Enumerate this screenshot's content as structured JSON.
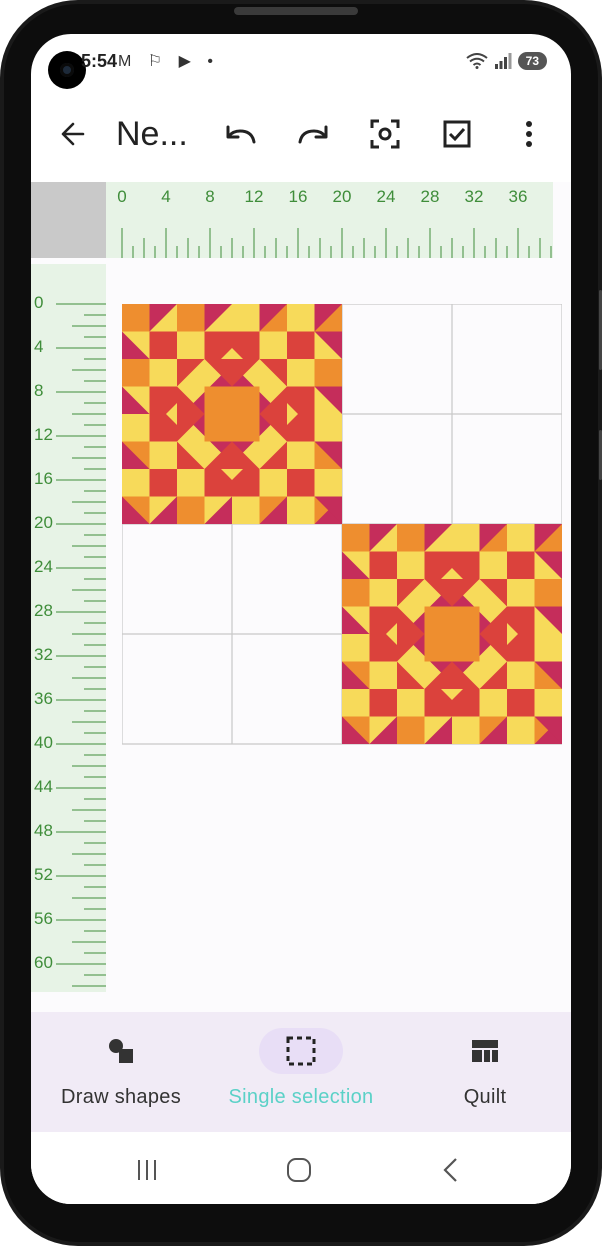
{
  "status_bar": {
    "time": "5:54",
    "notification_icons": [
      "gmail-icon",
      "notification-icon",
      "app-icon",
      "dot-icon"
    ],
    "battery": "73"
  },
  "toolbar": {
    "title": "Ne...",
    "actions": [
      "back-arrow-icon",
      "undo-icon",
      "redo-icon",
      "focus-icon",
      "check-box-icon",
      "more-vert-icon"
    ]
  },
  "ruler_top": {
    "labels": [
      "0",
      "4",
      "8",
      "12",
      "16",
      "20",
      "24",
      "28",
      "32",
      "36"
    ]
  },
  "ruler_left": {
    "labels": [
      "0",
      "4",
      "8",
      "12",
      "16",
      "20",
      "24",
      "28",
      "32",
      "36",
      "40",
      "44",
      "48",
      "52",
      "56",
      "60"
    ]
  },
  "colors": {
    "ruler_bg": "#e7f3e6",
    "ruler_ink": "#3f8d3a",
    "yellow": "#f7da5a",
    "orange": "#ee8e2f",
    "red": "#db423c",
    "magenta": "#c52d5b",
    "accent": "#5bd1c7",
    "nav_bg": "#f1ebf6",
    "pill": "#e8def6"
  },
  "bottom_nav": {
    "items": [
      {
        "label": "Draw shapes",
        "icon": "shapes-icon"
      },
      {
        "label": "Single selection",
        "icon": "selection-icon"
      },
      {
        "label": "Quilt",
        "icon": "quilt-icon"
      }
    ]
  },
  "system_nav": [
    "recents-icon",
    "home-icon",
    "back-icon"
  ]
}
